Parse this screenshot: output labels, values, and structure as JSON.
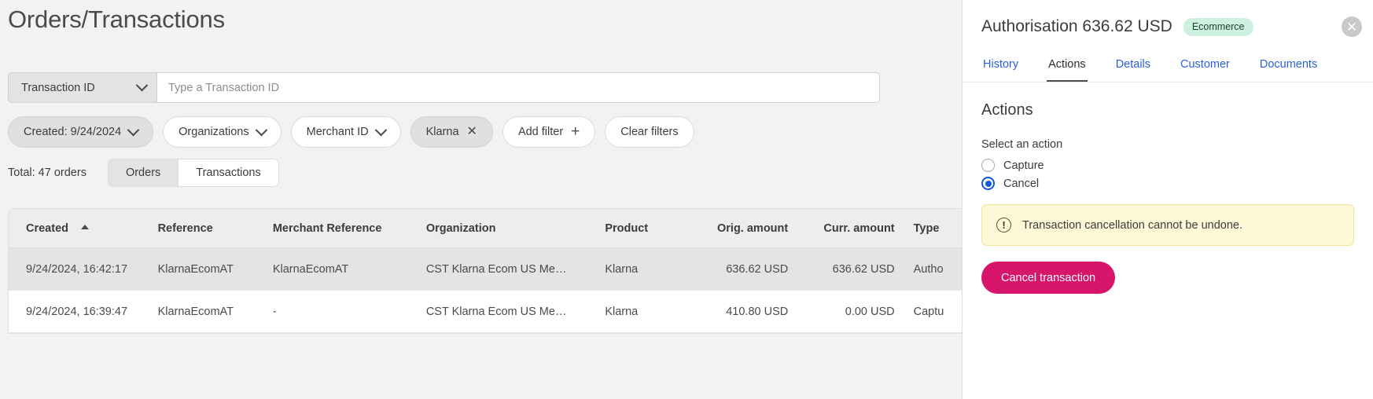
{
  "page": {
    "title": "Orders/Transactions"
  },
  "search": {
    "select_value": "Transaction ID",
    "placeholder": "Type a Transaction ID",
    "chevron_icon": "chevron-down-icon"
  },
  "filters": {
    "chips": [
      {
        "label": "Created: 9/24/2024",
        "trailing": "chevron-down-icon",
        "active": true
      },
      {
        "label": "Organizations",
        "trailing": "chevron-down-icon",
        "active": false
      },
      {
        "label": "Merchant ID",
        "trailing": "chevron-down-icon",
        "active": false
      },
      {
        "label": "Klarna",
        "trailing": "close-icon",
        "active": true
      },
      {
        "label": "Add filter",
        "trailing": "plus-icon",
        "active": false
      },
      {
        "label": "Clear filters",
        "trailing": "none",
        "active": false
      }
    ],
    "x_glyph": "✕",
    "plus_glyph": "＋"
  },
  "summary": {
    "total_label": "Total: 47 orders",
    "segments": [
      {
        "label": "Orders",
        "active": true
      },
      {
        "label": "Transactions",
        "active": false
      }
    ]
  },
  "table": {
    "sort_column": "Created",
    "sort_direction": "asc",
    "columns": [
      "Created",
      "Reference",
      "Merchant Reference",
      "Organization",
      "Product",
      "Orig. amount",
      "Curr. amount",
      "Type"
    ],
    "rows": [
      {
        "created": "9/24/2024, 16:42:17",
        "reference": "KlarnaEcomAT",
        "merchant_reference": "KlarnaEcomAT",
        "organization": "CST Klarna Ecom US Me…",
        "product": "Klarna",
        "orig_amount": "636.62 USD",
        "curr_amount": "636.62 USD",
        "type": "Autho",
        "selected": true
      },
      {
        "created": "9/24/2024, 16:39:47",
        "reference": "KlarnaEcomAT",
        "merchant_reference": "-",
        "organization": "CST Klarna Ecom US Me…",
        "product": "Klarna",
        "orig_amount": "410.80 USD",
        "curr_amount": "0.00 USD",
        "type": "Captu",
        "selected": false
      }
    ]
  },
  "panel": {
    "title": "Authorisation 636.62 USD",
    "badge": "Ecommerce",
    "close_icon": "close-icon",
    "close_glyph": "✕",
    "tabs": [
      {
        "label": "History",
        "active": false
      },
      {
        "label": "Actions",
        "active": true
      },
      {
        "label": "Details",
        "active": false
      },
      {
        "label": "Customer",
        "active": false
      },
      {
        "label": "Documents",
        "active": false
      }
    ],
    "actions": {
      "heading": "Actions",
      "field_label": "Select an action",
      "options": [
        {
          "label": "Capture",
          "checked": false
        },
        {
          "label": "Cancel",
          "checked": true
        }
      ],
      "warning": {
        "icon": "exclamation-circle-icon",
        "glyph": "!",
        "text": "Transaction cancellation cannot be undone."
      },
      "submit_label": "Cancel transaction"
    }
  },
  "colors": {
    "accent_link": "#2b5fd9",
    "radio_checked": "#1257d6",
    "danger": "#d6156b",
    "badge_bg": "#cdf0e0",
    "warning_bg": "#fdf8d5",
    "page_bg": "#f2f2f2"
  }
}
